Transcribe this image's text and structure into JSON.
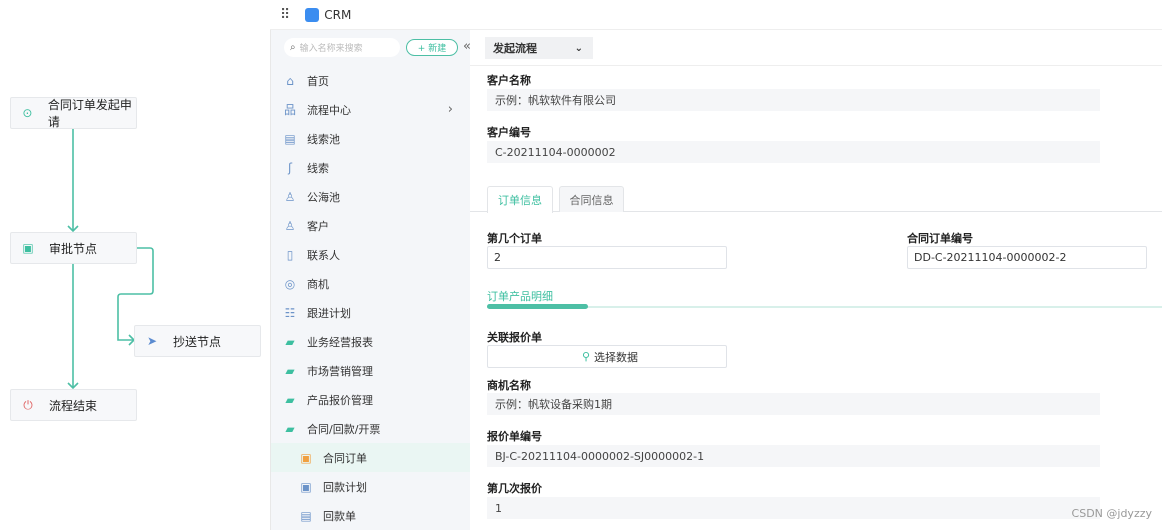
{
  "flow": {
    "nodes": [
      {
        "label": "合同订单发起申请",
        "icon": "play-circle-icon"
      },
      {
        "label": "审批节点",
        "icon": "approve-icon"
      },
      {
        "label": "抄送节点",
        "icon": "send-icon"
      },
      {
        "label": "流程结束",
        "icon": "power-icon"
      }
    ]
  },
  "topbar": {
    "app_name": "CRM"
  },
  "sidebar": {
    "search_placeholder": "输入名称来搜索",
    "new_label": "+ 新建",
    "collapse": "«",
    "items": [
      {
        "label": "首页",
        "icon": "⌂"
      },
      {
        "label": "流程中心",
        "icon": "品"
      },
      {
        "label": "线索池",
        "icon": "▤"
      },
      {
        "label": "线索",
        "icon": "ʃ"
      },
      {
        "label": "公海池",
        "icon": "♙"
      },
      {
        "label": "客户",
        "icon": "♙"
      },
      {
        "label": "联系人",
        "icon": "▯"
      },
      {
        "label": "商机",
        "icon": "◎"
      },
      {
        "label": "跟进计划",
        "icon": "☷"
      },
      {
        "label": "业务经营报表",
        "icon": "▰"
      },
      {
        "label": "市场营销管理",
        "icon": "▰"
      },
      {
        "label": "产品报价管理",
        "icon": "▰"
      },
      {
        "label": "合同/回款/开票",
        "icon": "▰"
      },
      {
        "label": "合同订单",
        "icon": "▣"
      },
      {
        "label": "回款计划",
        "icon": "▣"
      },
      {
        "label": "回款单",
        "icon": "▤"
      }
    ]
  },
  "main": {
    "dropdown": "发起流程",
    "customer_name_label": "客户名称",
    "customer_name": "示例：帆软软件有限公司",
    "customer_no_label": "客户编号",
    "customer_no": "C-20211104-0000002",
    "tabs": [
      "订单信息",
      "合同信息"
    ],
    "order_index_label": "第几个订单",
    "order_index": "2",
    "contract_order_no_label": "合同订单编号",
    "contract_order_no": "DD-C-20211104-0000002-2",
    "section_title": "订单产品明细",
    "section_progress": 0.15,
    "quote_label": "关联报价单",
    "select_data": "选择数据",
    "opportunity_label": "商机名称",
    "opportunity": "示例：帆软设备采购1期",
    "quote_no_label": "报价单编号",
    "quote_no": "BJ-C-20211104-0000002-SJ0000002-1",
    "quote_times_label": "第几次报价",
    "quote_times": "1"
  },
  "watermark": "CSDN @jdyzzy",
  "colors": {
    "accent": "#3dbfa0"
  }
}
